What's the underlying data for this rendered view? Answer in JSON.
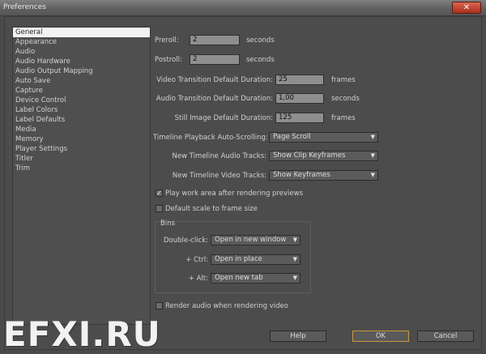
{
  "window": {
    "title": "Preferences",
    "close_icon": "✕"
  },
  "sidebar": {
    "items": [
      {
        "label": "General",
        "selected": true
      },
      {
        "label": "Appearance"
      },
      {
        "label": "Audio"
      },
      {
        "label": "Audio Hardware"
      },
      {
        "label": "Audio Output Mapping"
      },
      {
        "label": "Auto Save"
      },
      {
        "label": "Capture"
      },
      {
        "label": "Device Control"
      },
      {
        "label": "Label Colors"
      },
      {
        "label": "Label Defaults"
      },
      {
        "label": "Media"
      },
      {
        "label": "Memory"
      },
      {
        "label": "Player Settings"
      },
      {
        "label": "Titler"
      },
      {
        "label": "Trim"
      }
    ]
  },
  "general": {
    "preroll": {
      "label": "Preroll:",
      "value": "2",
      "unit": "seconds"
    },
    "postroll": {
      "label": "Postroll:",
      "value": "2",
      "unit": "seconds"
    },
    "video_transition": {
      "label": "Video Transition Default Duration:",
      "value": "25",
      "unit": "frames"
    },
    "audio_transition": {
      "label": "Audio Transition Default Duration:",
      "value": "1,00",
      "unit": "seconds"
    },
    "still_image": {
      "label": "Still Image Default Duration:",
      "value": "125",
      "unit": "frames"
    },
    "timeline_autoscroll": {
      "label": "Timeline Playback Auto-Scrolling:",
      "value": "Page Scroll"
    },
    "audio_tracks": {
      "label": "New Timeline Audio Tracks:",
      "value": "Show Clip Keyframes"
    },
    "video_tracks": {
      "label": "New Timeline Video Tracks:",
      "value": "Show Keyframes"
    },
    "play_work_area": {
      "label": "Play work area after rendering previews",
      "checked": true
    },
    "default_scale": {
      "label": "Default scale to frame size",
      "checked": false
    },
    "bins": {
      "title": "Bins",
      "double_click": {
        "label": "Double-click:",
        "value": "Open in new window"
      },
      "ctrl": {
        "label": "+ Ctrl:",
        "value": "Open in place"
      },
      "alt": {
        "label": "+ Alt:",
        "value": "Open new tab"
      }
    },
    "render_audio": {
      "label": "Render audio when rendering video",
      "checked": false
    }
  },
  "buttons": {
    "help": "Help",
    "ok": "OK",
    "cancel": "Cancel"
  },
  "check_glyph": "✓",
  "dropdown_arrow": "▼",
  "watermark": "EFXI.RU"
}
